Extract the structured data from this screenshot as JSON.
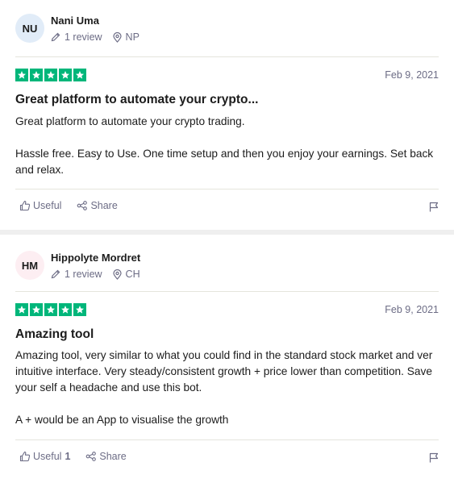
{
  "reviews": [
    {
      "initials": "NU",
      "avatar_color": "#e1ecf8",
      "name": "Nani Uma",
      "review_count": "1 review",
      "country": "NP",
      "rating": 5,
      "date": "Feb 9, 2021",
      "title": "Great platform to automate your crypto...",
      "paragraphs": [
        "Great platform to automate your crypto trading.",
        "Hassle free. Easy to Use. One time setup and then you enjoy your earnings. Set back and relax."
      ],
      "useful_label": "Useful",
      "useful_count": "",
      "share_label": "Share"
    },
    {
      "initials": "HM",
      "avatar_color": "#fdeef2",
      "name": "Hippolyte Mordret",
      "review_count": "1 review",
      "country": "CH",
      "rating": 5,
      "date": "Feb 9, 2021",
      "title": "Amazing tool",
      "paragraphs": [
        "Amazing tool, very similar to what you could find in the standard stock market and ver intuitive interface. Very steady/consistent growth + price lower than competition. Save your self a headache and use this bot.",
        "A + would be an App to visualise the growth"
      ],
      "useful_label": "Useful",
      "useful_count": "1",
      "share_label": "Share"
    }
  ],
  "colors": {
    "star": "#00b67a",
    "muted": "#6c6c85"
  },
  "icons": [
    "pencil-icon",
    "location-pin-icon",
    "star-icon",
    "thumbs-up-icon",
    "share-icon",
    "flag-icon"
  ]
}
